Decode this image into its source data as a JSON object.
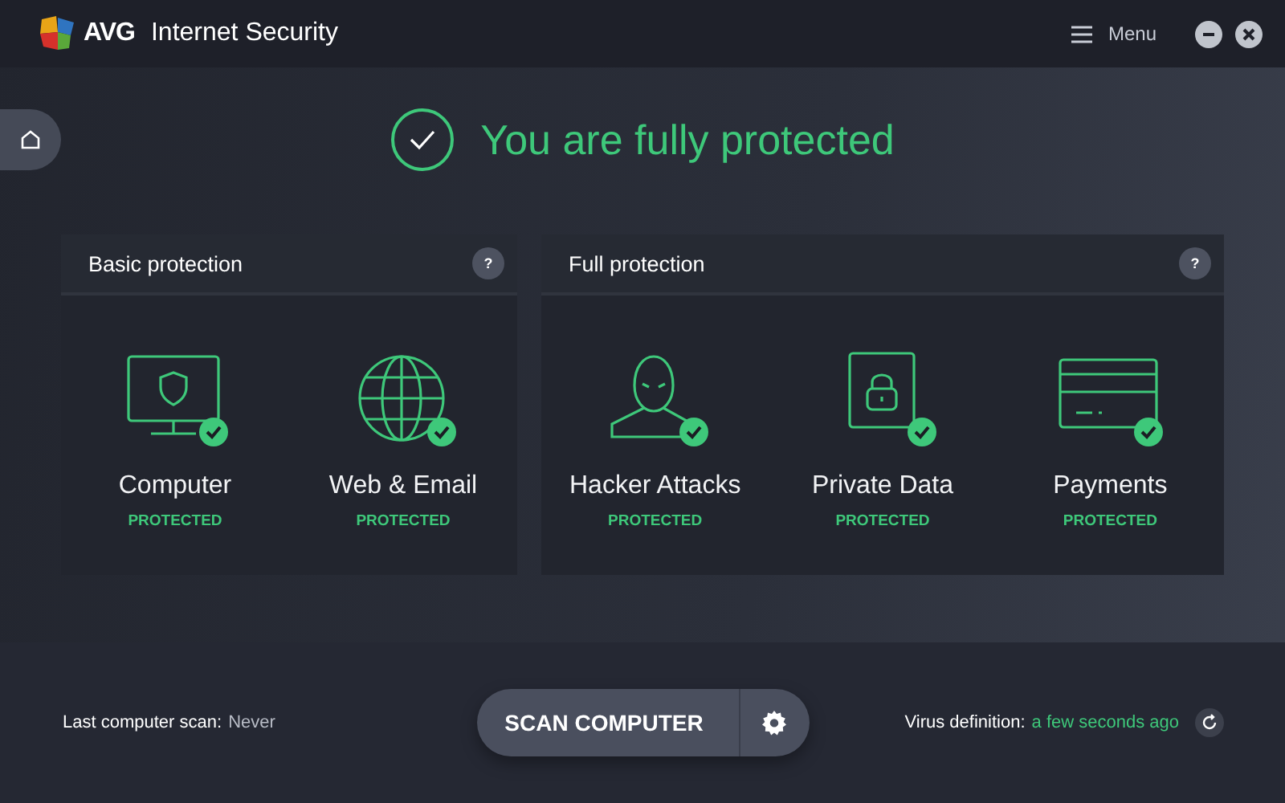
{
  "window": {
    "brand": "AVG",
    "title": "Internet Security",
    "menu_label": "Menu"
  },
  "status": {
    "headline": "You are fully protected",
    "protected": true
  },
  "panels": [
    {
      "title": "Basic protection",
      "help": "?",
      "items": [
        {
          "kind": "computer",
          "label": "Computer",
          "status": "PROTECTED",
          "protected": true
        },
        {
          "kind": "globe",
          "label": "Web & Email",
          "status": "PROTECTED",
          "protected": true
        }
      ]
    },
    {
      "title": "Full protection",
      "help": "?",
      "items": [
        {
          "kind": "hacker",
          "label": "Hacker Attacks",
          "status": "PROTECTED",
          "protected": true
        },
        {
          "kind": "document-lock",
          "label": "Private Data",
          "status": "PROTECTED",
          "protected": true
        },
        {
          "kind": "card",
          "label": "Payments",
          "status": "PROTECTED",
          "protected": true
        }
      ]
    }
  ],
  "footer": {
    "last_scan_label": "Last computer scan:",
    "last_scan_value": "Never",
    "scan_button": "SCAN COMPUTER",
    "virus_label": "Virus definition:",
    "virus_value": "a few seconds ago"
  }
}
